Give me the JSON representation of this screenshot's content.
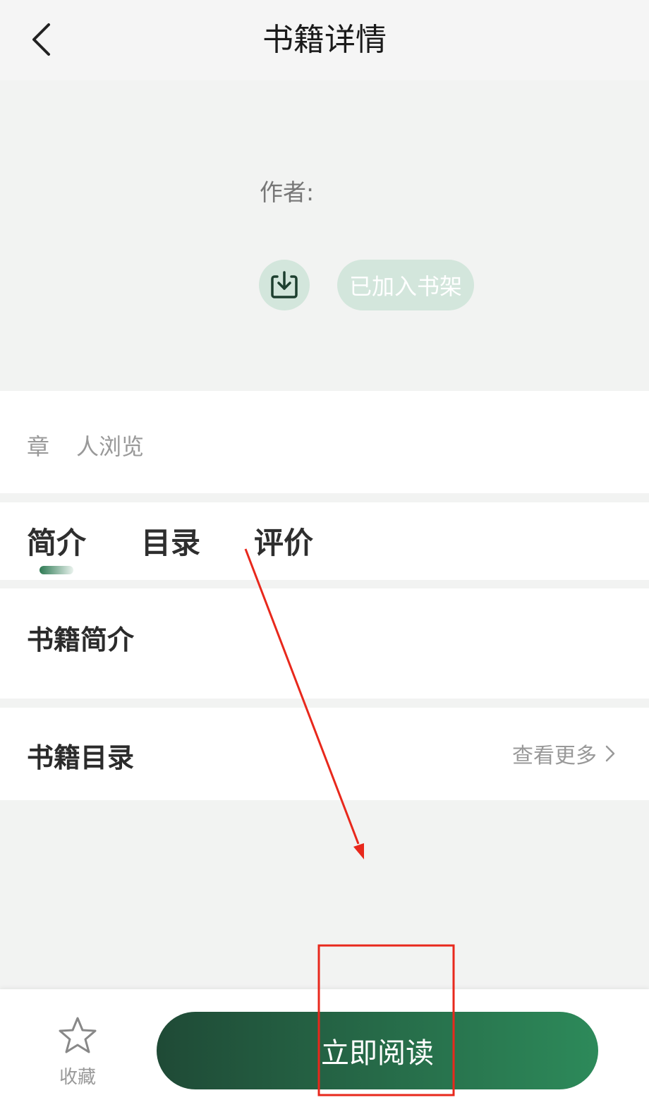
{
  "header": {
    "title": "书籍详情",
    "back_icon": "chevron-left-icon"
  },
  "book": {
    "author_label": "作者:",
    "download_icon": "download-icon",
    "shelf_button": "已加入书架",
    "stats": {
      "chapters_suffix": "章",
      "views_suffix": "人浏览"
    }
  },
  "tabs": [
    {
      "label": "简介",
      "active": true
    },
    {
      "label": "目录",
      "active": false
    },
    {
      "label": "评价",
      "active": false
    }
  ],
  "intro": {
    "title": "书籍简介"
  },
  "catalog": {
    "title": "书籍目录",
    "more_label": "查看更多"
  },
  "bottom_bar": {
    "favorite_label": "收藏",
    "favorite_icon": "star-icon",
    "read_button": "立即阅读"
  },
  "colors": {
    "accent": "#2d8a5a",
    "accent_dark": "#1f4a36",
    "shelf_bg": "#d3e6dc",
    "annotation": "#e8281c"
  }
}
